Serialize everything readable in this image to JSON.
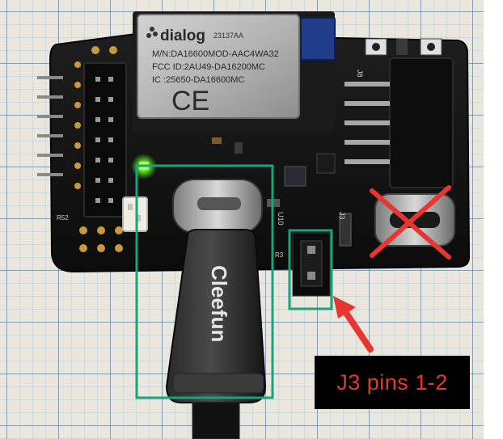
{
  "image": {
    "scene": "pcb-on-grid-paper",
    "module_brand": "dialog",
    "module_part_code": "23137AA",
    "module_model": "M/N:DA16600MOD-AAC4WA32",
    "module_fcc": "FCC ID:2AU49-DA16200MC",
    "module_ic": "IC :25650-DA16600MC",
    "module_ce_mark": "CE",
    "adapter_brand": "Cleefun",
    "silkscreen": [
      "J8",
      "J3",
      "U10",
      "R52",
      "R3"
    ],
    "annotation_label": "J3 pins 1-2",
    "colors": {
      "annotation_text": "#e8352f",
      "annotation_box": "#000000",
      "highlight_outline": "#1aa37a",
      "cross_mark": "#e8352f",
      "arrow": "#e8352f",
      "board": "#151515",
      "grid_paper": "#e9e6dd",
      "grid_line": "#4a7aa8"
    }
  }
}
